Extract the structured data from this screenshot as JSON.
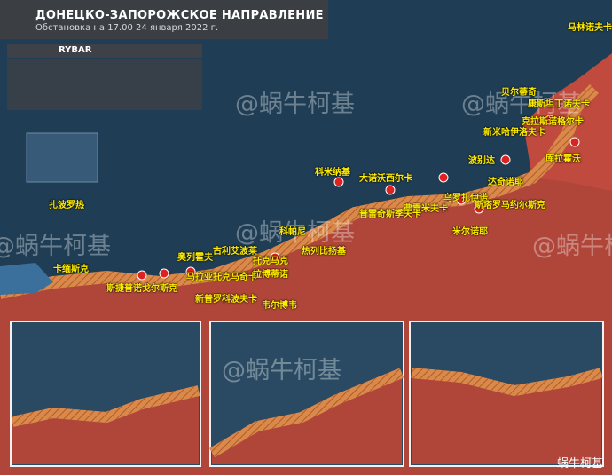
{
  "title": {
    "line1": "ДОНЕЦКО-ЗАПОРОЖСКОЕ НАПРАВЛЕНИЕ",
    "line2": "Обстановка на 17.00 24 января 2022 г."
  },
  "brand": {
    "name": "RYBAR"
  },
  "watermark": "@蜗牛柯基",
  "footer": "蜗牛柯基",
  "labels": {
    "malinovka": "马林诺夫卡",
    "belnoye": "贝尔蒂奇",
    "konstantinovka": "康斯坦丁诺夫卡",
    "krasnogorovka": "克拉斯诺格尔卡",
    "novomikhailovka": "新米哈伊洛夫卡",
    "pobeda": "波别达",
    "kurakhovo": "库拉霍沃",
    "dachnoye": "达奇诺耶",
    "komarivka": "科米纳基",
    "velykaNovoselka": "大诺沃西尔卡",
    "urozhainoe": "乌罗扎伊诺",
    "staromayorske": "斯塔罗马约尔斯克",
    "vremevka": "弗雷米夫卡",
    "prechistovka": "普雷奇斯季夫卡",
    "zaporizhzhia": "扎波罗热",
    "gulyaipole": "古利艾波莱",
    "orekhov": "奥列霍夫",
    "kamianske": "卡缅斯克",
    "stepnogorsk": "斯捷普诺戈尔斯克",
    "malaya_tokmachka": "马拉亚托克马奇卡",
    "rabotino": "拉博蒂诺",
    "novoprokopovka": "新普罗科波夫卡",
    "verbove": "韦尔博韦",
    "kopani": "科帕尼",
    "zherebyanki": "热列比扬基",
    "tokmak": "托克马克",
    "mirnoe": "米尔诺耶"
  }
}
